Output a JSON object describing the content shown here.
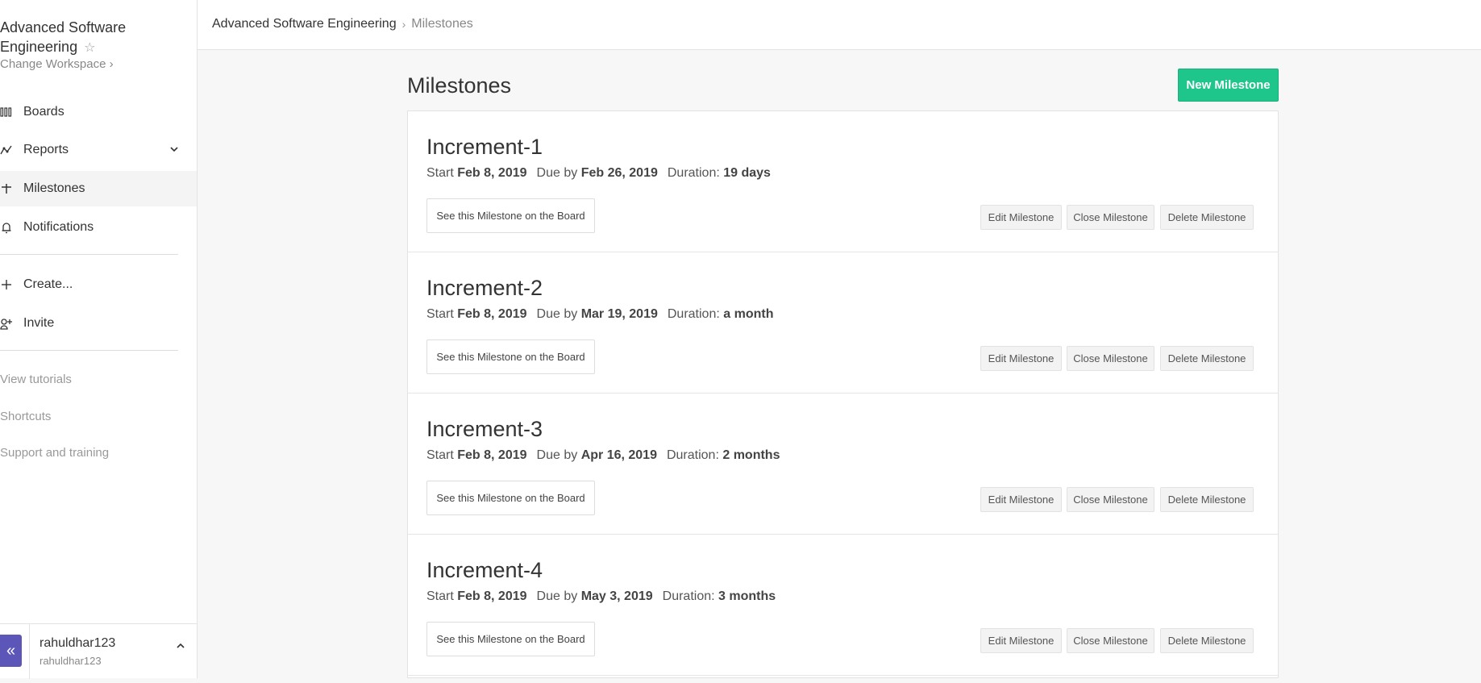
{
  "sidebar": {
    "workspace_title": "Advanced Software Engineering",
    "change_workspace": "Change Workspace ›",
    "items": [
      {
        "label": "Boards",
        "icon": "boards-icon"
      },
      {
        "label": "Reports",
        "icon": "reports-icon"
      },
      {
        "label": "Milestones",
        "icon": "milestones-icon"
      },
      {
        "label": "Notifications",
        "icon": "bell-icon"
      },
      {
        "label": "Create...",
        "icon": "plus-icon"
      },
      {
        "label": "Invite",
        "icon": "invite-icon"
      }
    ],
    "links": [
      "View tutorials",
      "Shortcuts",
      "Support and training"
    ],
    "user": {
      "name": "rahuldhar123",
      "handle": "rahuldhar123"
    }
  },
  "breadcrumb": {
    "workspace": "Advanced Software Engineering",
    "page": "Milestones"
  },
  "main": {
    "title": "Milestones",
    "new_button": "New Milestone"
  },
  "labels": {
    "start": "Start",
    "due": "Due by",
    "duration": "Duration:",
    "see_board": "See this Milestone on the Board",
    "edit": "Edit Milestone",
    "close": "Close Milestone",
    "delete": "Delete Milestone"
  },
  "milestones": [
    {
      "name": "Increment-1",
      "start": "Feb 8, 2019",
      "due": "Feb 26, 2019",
      "duration": "19 days"
    },
    {
      "name": "Increment-2",
      "start": "Feb 8, 2019",
      "due": "Mar 19, 2019",
      "duration": "a month"
    },
    {
      "name": "Increment-3",
      "start": "Feb 8, 2019",
      "due": "Apr 16, 2019",
      "duration": "2 months"
    },
    {
      "name": "Increment-4",
      "start": "Feb 8, 2019",
      "due": "May 3, 2019",
      "duration": "3 months"
    }
  ],
  "colors": {
    "accent": "#1fc68c",
    "collapse": "#5c56b8"
  }
}
